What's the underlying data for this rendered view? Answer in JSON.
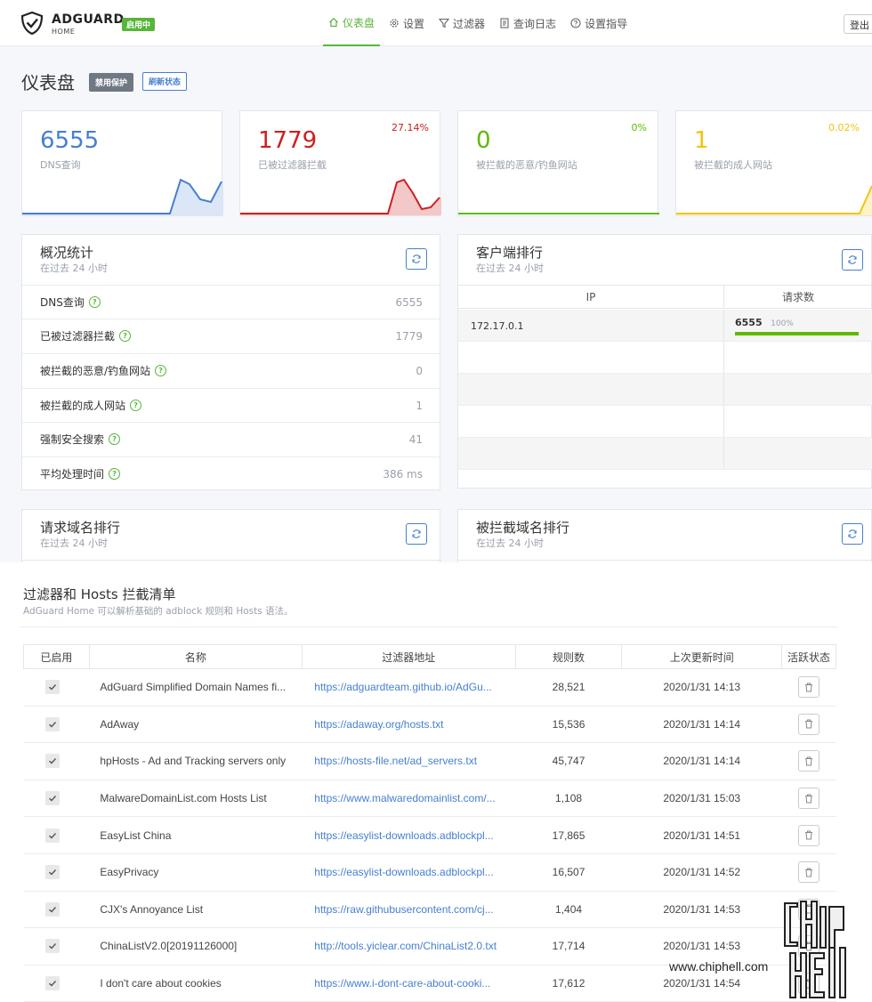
{
  "header": {
    "brand": "ADGUARD",
    "brand_sub": "HOME",
    "status_badge": "启用中",
    "nav": [
      {
        "label": "仪表盘",
        "icon": "home-icon",
        "active": true
      },
      {
        "label": "设置",
        "icon": "gear-icon",
        "active": false
      },
      {
        "label": "过滤器",
        "icon": "filter-icon",
        "active": false
      },
      {
        "label": "查询日志",
        "icon": "log-icon",
        "active": false
      },
      {
        "label": "设置指导",
        "icon": "help-icon",
        "active": false
      }
    ],
    "logout": "登出"
  },
  "dashboard": {
    "title": "仪表盘",
    "disable_btn": "禁用保护",
    "refresh_btn": "刷新状态"
  },
  "stats_cards": [
    {
      "value": "6555",
      "label": "DNS查询",
      "percent": "",
      "color": "#467fcf"
    },
    {
      "value": "1779",
      "label": "已被过滤器拦截",
      "percent": "27.14%",
      "color": "#cd201f"
    },
    {
      "value": "0",
      "label": "被拦截的恶意/钓鱼网站",
      "percent": "0%",
      "color": "#5eba00"
    },
    {
      "value": "1",
      "label": "被拦截的成人网站",
      "percent": "0.02%",
      "color": "#f1c40f"
    }
  ],
  "overview": {
    "title": "概况统计",
    "subtitle": "在过去 24 小时",
    "rows": [
      {
        "label": "DNS查询",
        "value": "6555"
      },
      {
        "label": "已被过滤器拦截",
        "value": "1779"
      },
      {
        "label": "被拦截的恶意/钓鱼网站",
        "value": "0"
      },
      {
        "label": "被拦截的成人网站",
        "value": "1"
      },
      {
        "label": "强制安全搜索",
        "value": "41"
      },
      {
        "label": "平均处理时间",
        "value": "386 ms"
      }
    ]
  },
  "clients": {
    "title": "客户端排行",
    "subtitle": "在过去 24 小时",
    "col_ip": "IP",
    "col_count": "请求数",
    "rows": [
      {
        "ip": "172.17.0.1",
        "count": "6555",
        "percent": "100%",
        "fraction": 1.0
      }
    ]
  },
  "top_domains": {
    "title": "请求域名排行",
    "subtitle": "在过去 24 小时"
  },
  "blocked_domains": {
    "title": "被拦截域名排行",
    "subtitle": "在过去 24 小时"
  },
  "filters": {
    "title": "过滤器和 Hosts 拦截清单",
    "subtitle": "AdGuard Home 可以解析基础的 adblock 规则和 Hosts 语法。",
    "columns": [
      "已启用",
      "名称",
      "过滤器地址",
      "规则数",
      "上次更新时间",
      "活跃状态"
    ],
    "rows": [
      {
        "name": "AdGuard Simplified Domain Names fi...",
        "url": "https://adguardteam.github.io/AdGu...",
        "rules": "28,521",
        "updated": "2020/1/31 14:13"
      },
      {
        "name": "AdAway",
        "url": "https://adaway.org/hosts.txt",
        "rules": "15,536",
        "updated": "2020/1/31 14:14"
      },
      {
        "name": "hpHosts - Ad and Tracking servers only",
        "url": "https://hosts-file.net/ad_servers.txt",
        "rules": "45,747",
        "updated": "2020/1/31 14:14"
      },
      {
        "name": "MalwareDomainList.com Hosts List",
        "url": "https://www.malwaredomainlist.com/...",
        "rules": "1,108",
        "updated": "2020/1/31 15:03"
      },
      {
        "name": "EasyList China",
        "url": "https://easylist-downloads.adblockpl...",
        "rules": "17,865",
        "updated": "2020/1/31 14:51"
      },
      {
        "name": "EasyPrivacy",
        "url": "https://easylist-downloads.adblockpl...",
        "rules": "16,507",
        "updated": "2020/1/31 14:52"
      },
      {
        "name": "CJX's Annoyance List",
        "url": "https://raw.githubusercontent.com/cj...",
        "rules": "1,404",
        "updated": "2020/1/31 14:53"
      },
      {
        "name": "ChinaListV2.0[20191126000]",
        "url": "http://tools.yiclear.com/ChinaList2.0.txt",
        "rules": "17,714",
        "updated": "2020/1/31 14:53"
      },
      {
        "name": "I don't care about cookies",
        "url": "https://www.i-dont-care-about-cooki...",
        "rules": "17,612",
        "updated": "2020/1/31 14:54"
      }
    ]
  },
  "watermark": "www.chiphell.com"
}
